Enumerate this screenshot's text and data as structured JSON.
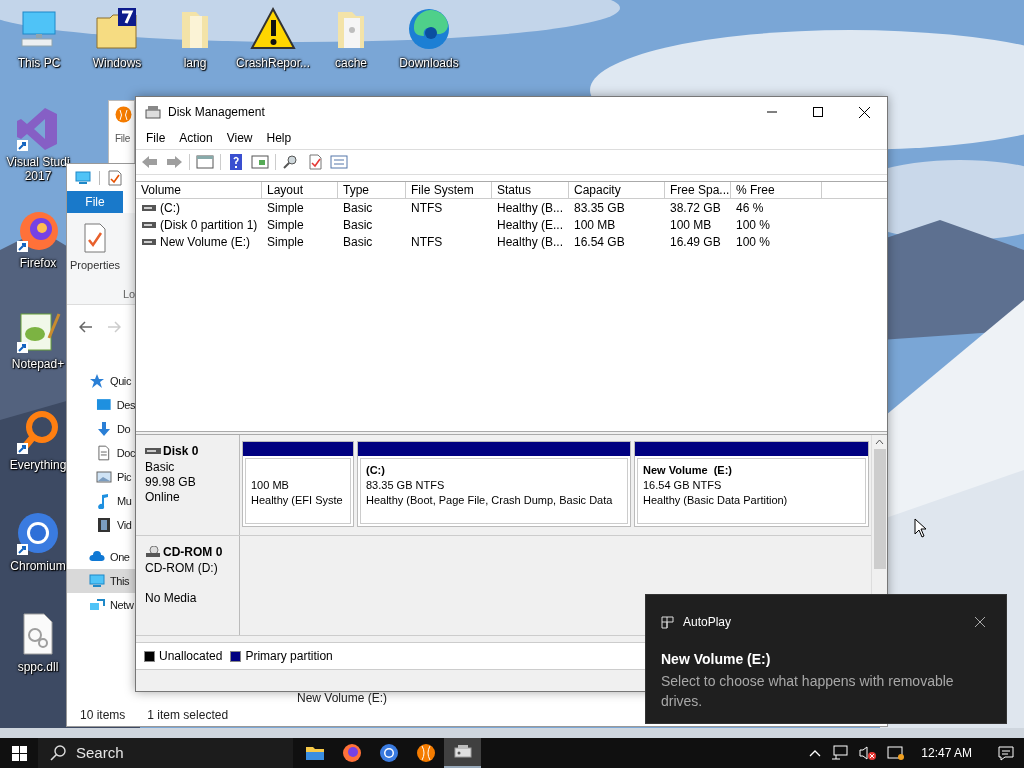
{
  "desktop": {
    "top_icons": [
      {
        "label": "This PC",
        "kind": "pc"
      },
      {
        "label": "Windows",
        "kind": "folder-badge"
      },
      {
        "label": "lang",
        "kind": "folder"
      },
      {
        "label": "CrashRepor...",
        "kind": "warning"
      },
      {
        "label": "cache",
        "kind": "folder-file"
      },
      {
        "label": "Downloads",
        "kind": "edge"
      }
    ],
    "side_icons": [
      {
        "label": "Visual Studi 2017",
        "kind": "vs"
      },
      {
        "label": "Firefox",
        "kind": "firefox"
      },
      {
        "label": "Notepad+",
        "kind": "notepad"
      },
      {
        "label": "Everything",
        "kind": "everything"
      },
      {
        "label": "Chromium",
        "kind": "chromium"
      },
      {
        "label": "sppc.dll",
        "kind": "dll"
      }
    ]
  },
  "back_window": {
    "ribbon_tab": "File"
  },
  "explorer": {
    "ribbon_tab": "File",
    "ribbon_button": "Properties",
    "ribbon_group": "Lo",
    "nav": [
      {
        "label": "Quic",
        "kind": "star",
        "selected": false,
        "children": [
          {
            "label": "Des",
            "kind": "desktop",
            "selected": false
          },
          {
            "label": "Do",
            "kind": "download",
            "selected": false
          },
          {
            "label": "Doc",
            "kind": "document",
            "selected": false
          },
          {
            "label": "Pic",
            "kind": "pictures",
            "selected": false
          },
          {
            "label": "Mu",
            "kind": "music",
            "selected": false
          },
          {
            "label": "Vid",
            "kind": "video",
            "selected": false
          }
        ]
      },
      {
        "label": "One",
        "kind": "cloud",
        "selected": false
      },
      {
        "label": "This",
        "kind": "pc",
        "selected": true
      },
      {
        "label": "Netw",
        "kind": "network",
        "selected": false
      }
    ],
    "items_count": "10 items",
    "selection": "1 item selected",
    "peek_text": "New Volume (E:)"
  },
  "disk_management": {
    "title": "Disk Management",
    "menu": [
      "File",
      "Action",
      "View",
      "Help"
    ],
    "table": {
      "columns": [
        "Volume",
        "Layout",
        "Type",
        "File System",
        "Status",
        "Capacity",
        "Free Spa...",
        "% Free"
      ],
      "rows": [
        [
          "(C:)",
          "Simple",
          "Basic",
          "NTFS",
          "Healthy (B...",
          "83.35 GB",
          "38.72 GB",
          "46 %"
        ],
        [
          "(Disk 0 partition 1)",
          "Simple",
          "Basic",
          "",
          "Healthy (E...",
          "100 MB",
          "100 MB",
          "100 %"
        ],
        [
          "New Volume (E:)",
          "Simple",
          "Basic",
          "NTFS",
          "Healthy (B...",
          "16.54 GB",
          "16.49 GB",
          "100 %"
        ]
      ]
    },
    "disks": [
      {
        "name": "Disk 0",
        "kind": "disk",
        "lines": [
          "Basic",
          "99.98 GB"
        ],
        "status": "Online",
        "partitions": [
          {
            "size": "100 MB",
            "health": "Healthy (EFI Syste"
          },
          {
            "name": "(C:)",
            "size": "83.35 GB NTFS",
            "health": "Healthy (Boot, Page File, Crash Dump, Basic Data"
          },
          {
            "name": "New Volume  (E:)",
            "size": "16.54 GB NTFS",
            "health": "Healthy (Basic Data Partition)"
          }
        ]
      },
      {
        "name": "CD-ROM 0",
        "kind": "cdrom",
        "lines": [
          "CD-ROM (D:)"
        ],
        "status": "No Media"
      }
    ],
    "legend": [
      {
        "label": "Unallocated",
        "color": "#000000"
      },
      {
        "label": "Primary partition",
        "color": "#000080"
      }
    ]
  },
  "toast": {
    "app": "AutoPlay",
    "title": "New Volume (E:)",
    "body": "Select to choose what happens with removable drives."
  },
  "taskbar": {
    "search": "Search",
    "apps": [
      {
        "kind": "explorer",
        "selected": false
      },
      {
        "kind": "firefox",
        "selected": false
      },
      {
        "kind": "chromium",
        "selected": false
      },
      {
        "kind": "ball",
        "selected": false
      },
      {
        "kind": "disk",
        "selected": true
      }
    ],
    "clock": "12:47 AM"
  }
}
